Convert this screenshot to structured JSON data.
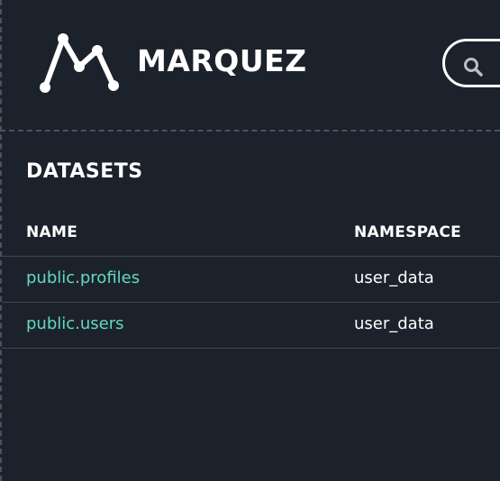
{
  "header": {
    "brand_name": "MARQUEZ",
    "logo_icon": "marquez-logo-icon",
    "search_icon": "search-icon"
  },
  "datasets": {
    "title": "DATASETS",
    "columns": [
      "NAME",
      "NAMESPACE"
    ],
    "rows": [
      {
        "name": "public.profiles",
        "namespace": "user_data"
      },
      {
        "name": "public.users",
        "namespace": "user_data"
      }
    ]
  },
  "colors": {
    "background": "#1c222b",
    "link": "#61d9c0",
    "text": "#ffffff",
    "divider": "#4a5261"
  }
}
